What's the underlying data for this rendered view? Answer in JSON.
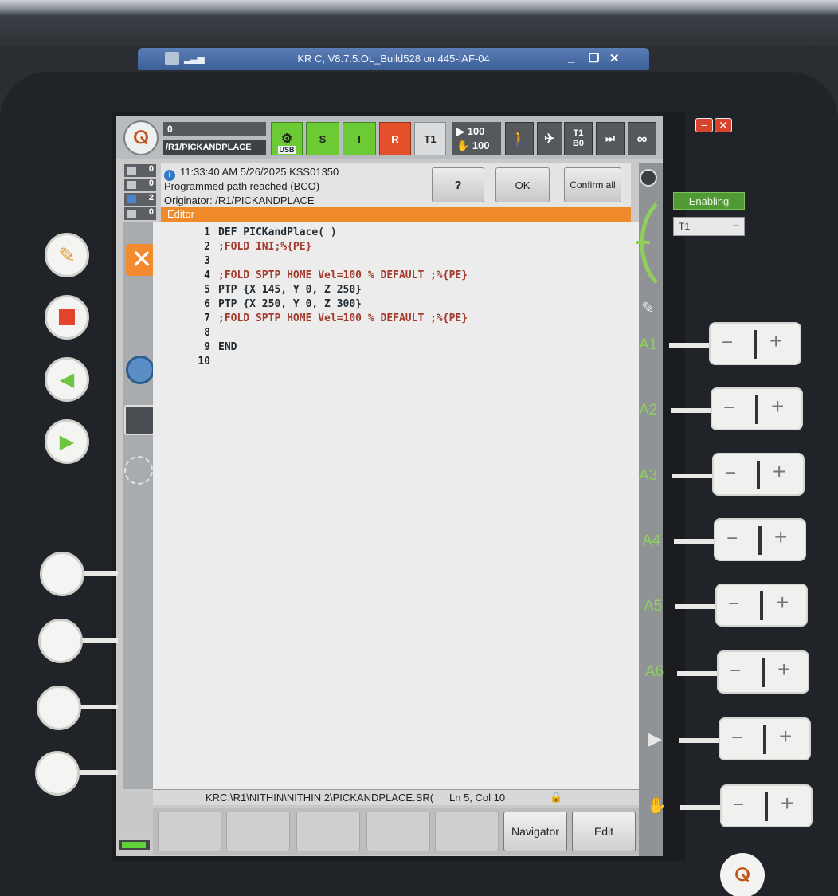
{
  "window": {
    "title": "KR C, V8.7.5.OL_Build528 on 445-IAF-04",
    "minimize": "_",
    "restore": "❐",
    "close": "✕"
  },
  "status_bar": {
    "robot_number": "0",
    "program_path": "/R1/PICKANDPLACE",
    "usb_label": "USB",
    "s_label": "S",
    "i_label": "I",
    "r_label": "R",
    "mode_label": "T1",
    "override_prog": "100",
    "override_jog": "100",
    "tool_label": "T1",
    "base_label": "B0",
    "loop_label": "∞"
  },
  "message": {
    "counters": [
      "0",
      "0",
      "2",
      "0"
    ],
    "time": "11:33:40 AM 5/26/2025 KSS01350",
    "text": "Programmed path reached (BCO)",
    "originator": "Originator: /R1/PICKANDPLACE",
    "help_button": "?",
    "ok_button": "OK",
    "confirm_all_button": "Confirm all"
  },
  "editor": {
    "title": "Editor",
    "lines": [
      {
        "n": "1",
        "text": "DEF PICKandPlace( )",
        "kind": "def"
      },
      {
        "n": "2",
        "text": ";FOLD INI;%{PE}",
        "kind": "fold"
      },
      {
        "n": "3",
        "text": "",
        "kind": "def"
      },
      {
        "n": "4",
        "text": ";FOLD SPTP HOME Vel=100 % DEFAULT ;%{PE}",
        "kind": "fold"
      },
      {
        "n": "5",
        "text": "PTP {X 145, Y 0, Z 250}",
        "kind": "def"
      },
      {
        "n": "6",
        "text": "PTP {X 250, Y 0, Z 300}",
        "kind": "def"
      },
      {
        "n": "7",
        "text": ";FOLD SPTP HOME Vel=100 % DEFAULT ;%{PE}",
        "kind": "fold"
      },
      {
        "n": "8",
        "text": "",
        "kind": "def"
      },
      {
        "n": "9",
        "text": "END",
        "kind": "def"
      },
      {
        "n": "10",
        "text": "",
        "kind": "def"
      }
    ],
    "file_path": "KRC:\\R1\\NITHIN\\NITHIN 2\\PICKANDPLACE.SR(",
    "cursor_position": "Ln 5, Col 10"
  },
  "softkeys": {
    "navigator": "Navigator",
    "edit": "Edit"
  },
  "jog": {
    "axes": [
      "A1",
      "A2",
      "A3",
      "A4",
      "A5",
      "A6"
    ],
    "minus": "−",
    "plus": "+"
  },
  "pendant": {
    "enabling": "Enabling",
    "mode_select": "T1",
    "close_glyph": "✕",
    "logo": "ⵕ"
  }
}
